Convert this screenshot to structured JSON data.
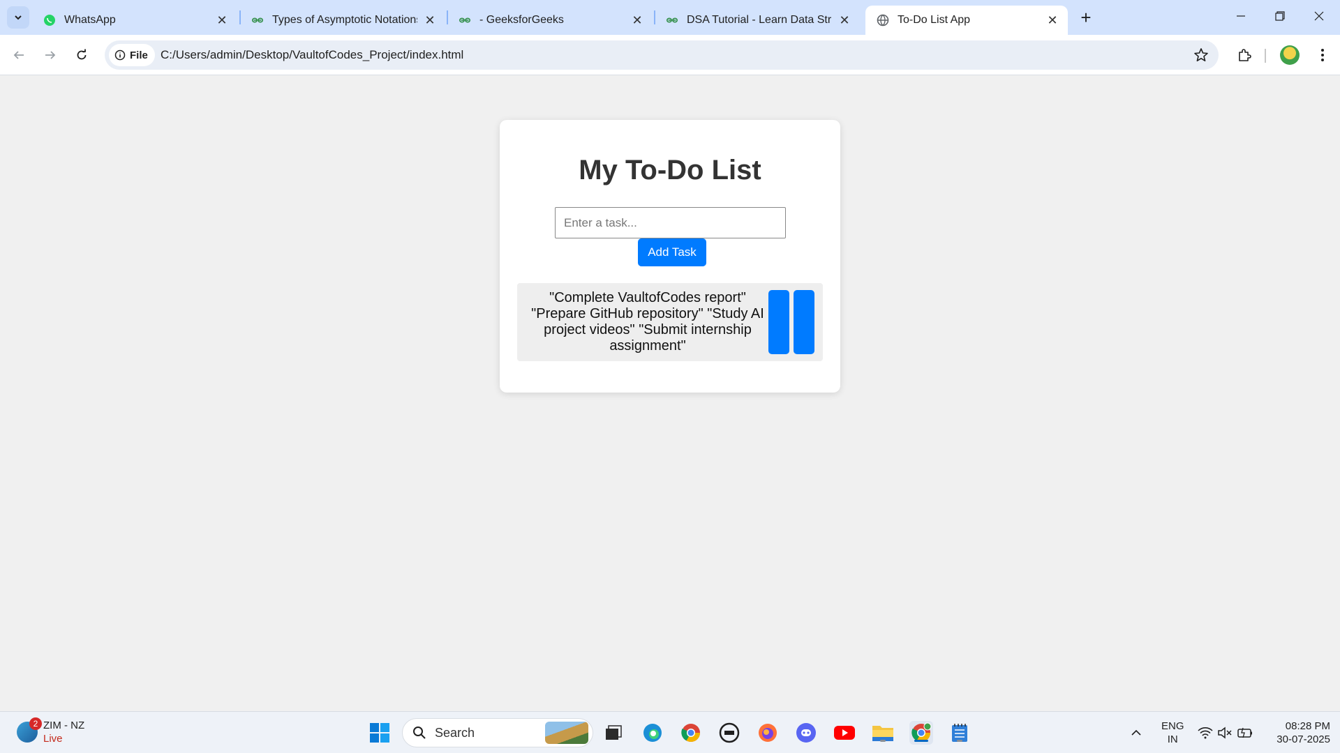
{
  "browser": {
    "tabs": [
      {
        "title": "WhatsApp",
        "icon": "whatsapp-icon",
        "active": false
      },
      {
        "title": "Types of Asymptotic Notations",
        "icon": "geeksforgeeks-icon",
        "active": false
      },
      {
        "title": "- GeeksforGeeks",
        "icon": "geeksforgeeks-icon",
        "active": false
      },
      {
        "title": "DSA Tutorial - Learn Data Struct",
        "icon": "geeksforgeeks-icon",
        "active": false
      },
      {
        "title": "To-Do List App",
        "icon": "globe-icon",
        "active": true
      }
    ],
    "new_tab_glyph": "+",
    "close_glyph": "✕",
    "file_chip": "File",
    "url": "C:/Users/admin/Desktop/VaultofCodes_Project/index.html"
  },
  "page": {
    "heading": "My To-Do List",
    "input_placeholder": "Enter a task...",
    "add_button": "Add Task",
    "task_text": "\"Complete VaultofCodes report\" \"Prepare GitHub repository\" \"Study AI project videos\" \"Submit internship assignment\"",
    "accent_color": "#007bff"
  },
  "taskbar": {
    "widget": {
      "title": "ZIM - NZ",
      "status": "Live",
      "badge": "2"
    },
    "search_label": "Search",
    "tray": {
      "language": "ENG",
      "region": "IN"
    },
    "clock": {
      "time": "08:28 PM",
      "date": "30-07-2025"
    }
  }
}
